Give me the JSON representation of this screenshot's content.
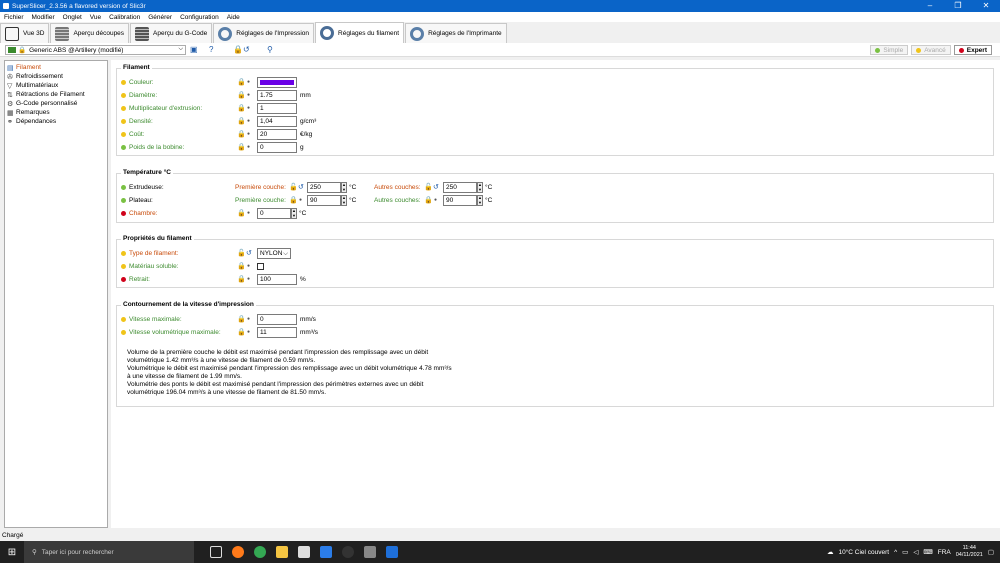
{
  "window": {
    "title": "SuperSlicer_2.3.56 a flavored version of Slic3r"
  },
  "menu": [
    "Fichier",
    "Modifier",
    "Onglet",
    "Vue",
    "Calibration",
    "Générer",
    "Configuration",
    "Aide"
  ],
  "tabs": [
    {
      "label": "Vue 3D",
      "icon": "cube-icon"
    },
    {
      "label": "Aperçu découpes",
      "icon": "layers-icon"
    },
    {
      "label": "Aperçu du G-Code",
      "icon": "gcode-icon"
    },
    {
      "label": "Réglages de l'Impression",
      "icon": "print-gear-icon"
    },
    {
      "label": "Réglages du filament",
      "icon": "filament-spool-icon"
    },
    {
      "label": "Réglages de l'Imprimante",
      "icon": "printer-gear-icon"
    }
  ],
  "toolbar": {
    "preset": "Generic ABS @Artillery (modifié)",
    "modes": [
      {
        "label": "Simple",
        "color": "#7ac143"
      },
      {
        "label": "Avancé",
        "color": "#f0c419"
      },
      {
        "label": "Expert",
        "color": "#d0021b"
      }
    ]
  },
  "sidebar": [
    {
      "label": "Filament",
      "icon": "filament-icon"
    },
    {
      "label": "Refroidissement",
      "icon": "cooling-icon"
    },
    {
      "label": "Multimatériaux",
      "icon": "multimaterial-icon"
    },
    {
      "label": "Rétractions de Filament",
      "icon": "retraction-icon"
    },
    {
      "label": "G-Code personnalisé",
      "icon": "gcode-icon"
    },
    {
      "label": "Remarques",
      "icon": "notes-icon"
    },
    {
      "label": "Dépendances",
      "icon": "dependencies-icon"
    }
  ],
  "filament": {
    "title": "Filament",
    "color_label": "Couleur:",
    "color_value": "#6a00e6",
    "diameter_label": "Diamètre:",
    "diameter_value": "1.75",
    "diameter_unit": "mm",
    "extrusion_label": "Multiplicateur d'extrusion:",
    "extrusion_value": "1",
    "density_label": "Densité:",
    "density_value": "1,04",
    "density_unit": "g/cm³",
    "cost_label": "Coût:",
    "cost_value": "20",
    "cost_unit": "€/kg",
    "spool_label": "Poids de la bobine:",
    "spool_value": "0",
    "spool_unit": "g"
  },
  "temperature": {
    "title": "Température °C",
    "extruder_label": "Extrudeuse:",
    "bed_label": "Plateau:",
    "chamber_label": "Chambre:",
    "first_layer_label": "Première couche:",
    "other_layers_label": "Autres couches:",
    "extruder_first": "250",
    "extruder_other": "250",
    "bed_first": "90",
    "bed_other": "90",
    "chamber_value": "0",
    "unit": "°C"
  },
  "properties": {
    "title": "Propriétés du filament",
    "type_label": "Type de filament:",
    "type_value": "NYLON",
    "soluble_label": "Matériau soluble:",
    "shrink_label": "Retrait:",
    "shrink_value": "100",
    "shrink_unit": "%"
  },
  "speed": {
    "title": "Contournement de la vitesse d'impression",
    "max_speed_label": "Vitesse maximale:",
    "max_speed_value": "0",
    "max_speed_unit": "mm/s",
    "max_vol_label": "Vitesse volumétrique maximale:",
    "max_vol_value": "11",
    "max_vol_unit": "mm³/s",
    "notes": [
      "Volume de la première couche le débit est maximisé pendant l'impression des remplissage avec un débit",
      "volumétrique 1.42 mm³/s à une vitesse de filament de 0.59 mm/s.",
      "Volumétrique le débit est maximisé pendant l'impression des remplissage avec un débit volumétrique 4.78 mm³/s",
      "à une vitesse de filament de 1.99 mm/s.",
      "Volumétrie des ponts le débit est maximisé pendant l'impression des périmètres externes avec un débit",
      "volumétrique 196.04 mm³/s à une vitesse de filament de 81.50 mm/s."
    ]
  },
  "status": {
    "text": "Chargé"
  },
  "taskbar": {
    "search_placeholder": "Taper ici pour rechercher",
    "weather": "10°C  Ciel couvert",
    "lang": "FRA",
    "time": "11:44",
    "date": "04/11/2021"
  }
}
